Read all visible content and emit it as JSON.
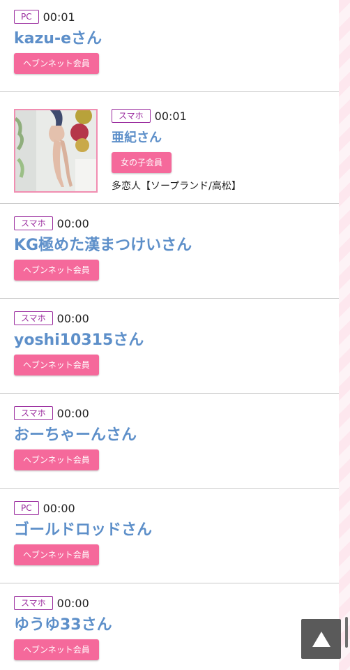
{
  "entries": [
    {
      "device": "PC",
      "time": "00:01",
      "name": "kazu-eさん",
      "badge": "ヘブンネット会員"
    },
    {
      "device": "スマホ",
      "time": "00:01",
      "name": "亜紀さん",
      "badge": "女の子会員",
      "shop": "多恋人【ソープランド/高松】"
    },
    {
      "device": "スマホ",
      "time": "00:00",
      "name": "KG極めた漢まつけいさん",
      "badge": "ヘブンネット会員"
    },
    {
      "device": "スマホ",
      "time": "00:00",
      "name": "yoshi10315さん",
      "badge": "ヘブンネット会員"
    },
    {
      "device": "スマホ",
      "time": "00:00",
      "name": "おーちゃーんさん",
      "badge": "ヘブンネット会員"
    },
    {
      "device": "PC",
      "time": "00:00",
      "name": "ゴールドロッドさん",
      "badge": "ヘブンネット会員"
    },
    {
      "device": "スマホ",
      "time": "00:00",
      "name": "ゆうゆ33さん",
      "badge": "ヘブンネット会員"
    }
  ],
  "colors": {
    "name": "#5d8fc9",
    "member_badge": "#f5699b",
    "device_badge": "#9a2b9e"
  },
  "icons": {
    "scroll_top": "triangle-up-icon",
    "entry_photo": "profile-photo"
  }
}
